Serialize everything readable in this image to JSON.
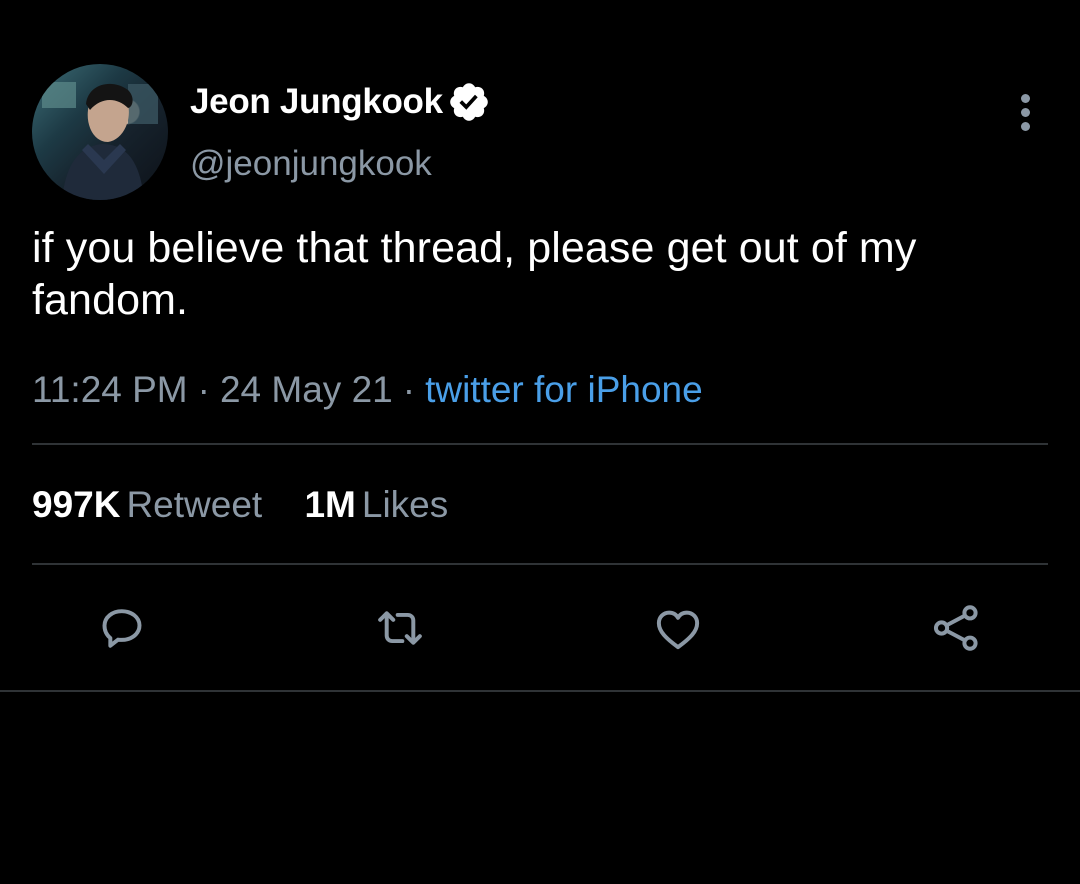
{
  "user": {
    "display_name": "Jeon Jungkook",
    "handle": "@jeonjungkook",
    "verified": true,
    "avatar_icon": "profile-photo"
  },
  "tweet": {
    "text": "if you believe that thread, please get out of my fandom.",
    "time": "11:24 PM",
    "date": "24 May 21",
    "separator": "·",
    "source": "twitter for iPhone"
  },
  "stats": {
    "retweets_count": "997K",
    "retweets_label": "Retweet",
    "likes_count": "1M",
    "likes_label": "Likes"
  },
  "actions": [
    {
      "name": "reply",
      "icon": "speech-bubble-icon"
    },
    {
      "name": "retweet",
      "icon": "retweet-icon"
    },
    {
      "name": "like",
      "icon": "heart-icon"
    },
    {
      "name": "share",
      "icon": "share-nodes-icon"
    }
  ],
  "colors": {
    "background": "#000000",
    "primary_text": "#ffffff",
    "secondary_text": "#8b98a5",
    "link": "#4a9fe8",
    "divider": "#2f3336"
  }
}
